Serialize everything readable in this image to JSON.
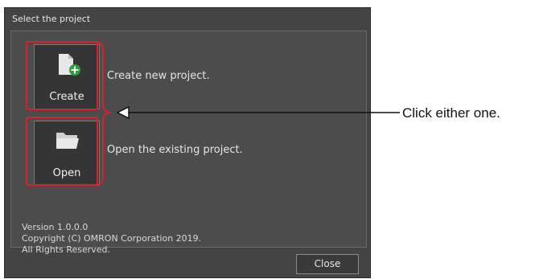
{
  "dialog": {
    "title": "Select the project",
    "create": {
      "label": "Create",
      "description": "Create new project.",
      "icon": "new-file-plus-icon"
    },
    "open": {
      "label": "Open",
      "description": "Open the existing project.",
      "icon": "folder-open-icon"
    },
    "version_lines": [
      "Version 1.0.0.0",
      "Copyright (C) OMRON Corporation 2019.",
      "All Rights Reserved."
    ],
    "close_label": "Close"
  },
  "annotation": {
    "callout_text": "Click either one.",
    "color": "#d9202c"
  },
  "colors": {
    "dialog_bg": "#444444",
    "button_bg": "#353535",
    "accent_green": "#2e9e3e"
  }
}
